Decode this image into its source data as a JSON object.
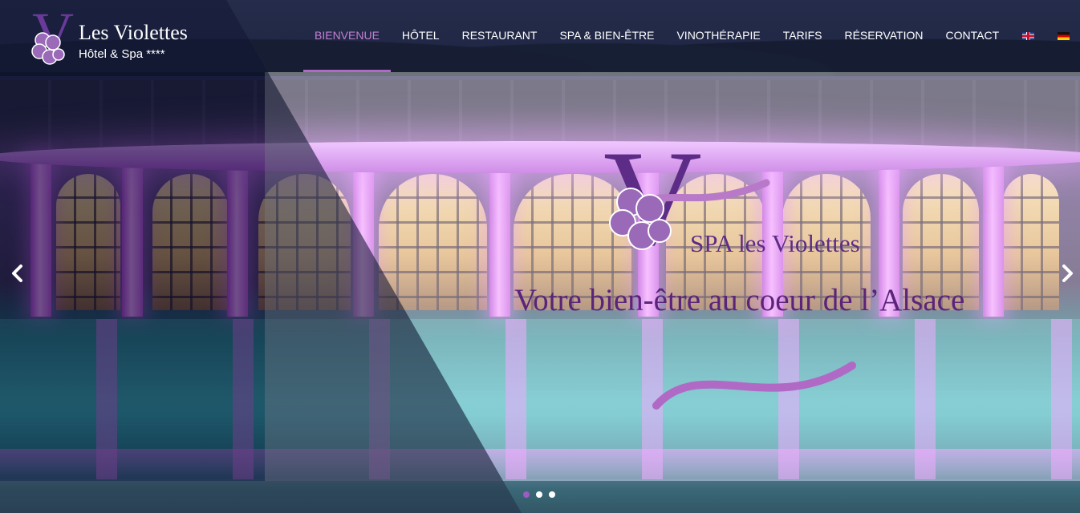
{
  "brand": {
    "logo_letter": "V",
    "title": "Les Violettes",
    "subtitle": "Hôtel & Spa ****",
    "accent_color": "#b06ac6",
    "primary_purple": "#5d2c86"
  },
  "nav": {
    "items": [
      {
        "label": "BIENVENUE",
        "active": true
      },
      {
        "label": "HÔTEL",
        "active": false
      },
      {
        "label": "RESTAURANT",
        "active": false
      },
      {
        "label": "SPA & BIEN-ÊTRE",
        "active": false
      },
      {
        "label": "VINOTHÉRAPIE",
        "active": false
      },
      {
        "label": "TARIFS",
        "active": false
      },
      {
        "label": "RÉSERVATION",
        "active": false
      },
      {
        "label": "CONTACT",
        "active": false
      }
    ],
    "languages": [
      {
        "icon": "flag-en-icon",
        "active": false
      },
      {
        "icon": "flag-de-icon",
        "active": false
      },
      {
        "icon": "flag-fr-icon",
        "active": true
      }
    ]
  },
  "slide": {
    "logo_letter": "V",
    "spa_name": "SPA les Violettes",
    "tagline": "Votre bien-être au coeur de l’Alsace",
    "prev_icon": "chevron-left-icon",
    "next_icon": "chevron-right-icon"
  },
  "carousel": {
    "slide_count": 3,
    "active_index": 0
  }
}
